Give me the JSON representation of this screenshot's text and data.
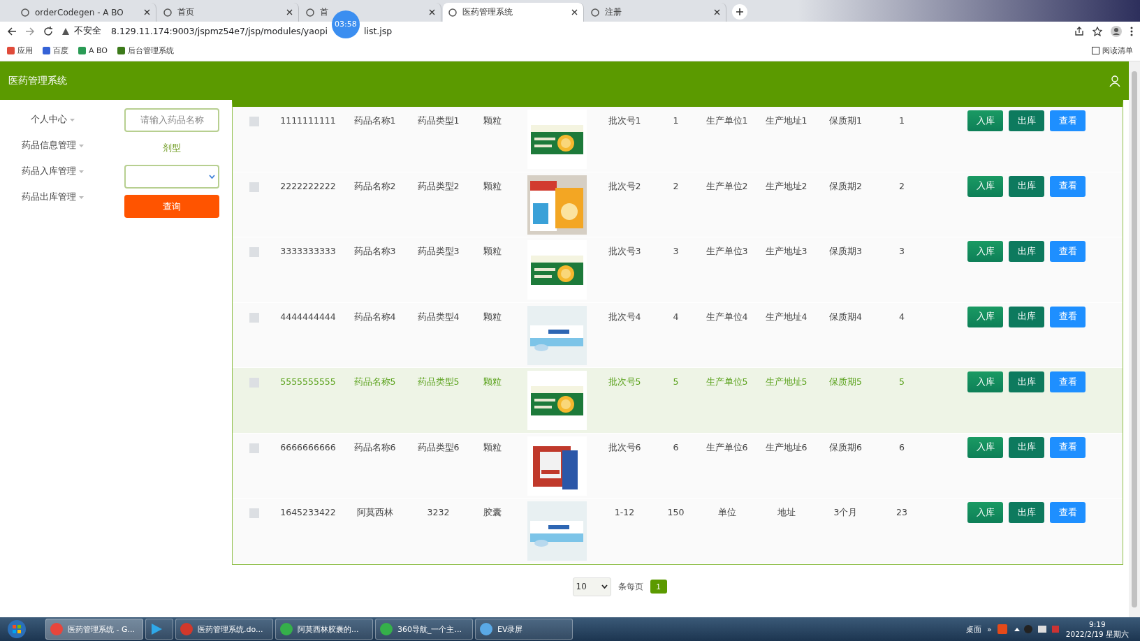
{
  "browser": {
    "tabs": [
      {
        "title": "orderCodegen - A BO",
        "selected": false
      },
      {
        "title": "首页",
        "selected": false
      },
      {
        "title": "首",
        "selected": false
      },
      {
        "title": "医药管理系统",
        "selected": true
      },
      {
        "title": "注册",
        "selected": false
      }
    ],
    "security": "不安全",
    "url_parts": [
      "8.129.11.174:9003/jspmz54e7/jsp/modules/yaopi",
      "list.jsp"
    ],
    "timer": "03:58",
    "bookmarks": [
      "应用",
      "百度",
      "A BO",
      "后台管理系统"
    ],
    "reading_list": "阅读清单"
  },
  "app": {
    "title": "医药管理系统"
  },
  "sidebar": {
    "items": [
      "个人中心",
      "药品信息管理",
      "药品入库管理",
      "药品出库管理"
    ]
  },
  "search": {
    "placeholder": "请输入药品名称",
    "form_label": "剂型",
    "button": "查询"
  },
  "table": {
    "rows": [
      {
        "checked": false,
        "highlighted": false,
        "cells": [
          "1111111111",
          "药品名称1",
          "药品类型1",
          "颗粒"
        ],
        "image": {
          "kind": "picture"
        },
        "cells_after": [
          "批次号1",
          "1",
          "生产单位1",
          "生产地址1",
          "保质期1",
          "1"
        ],
        "actions": [
          {
            "kind": "in",
            "label": "入库"
          },
          {
            "kind": "out",
            "label": "出库"
          },
          {
            "kind": "view",
            "label": "查看"
          }
        ]
      },
      {
        "checked": false,
        "highlighted": false,
        "cells": [
          "2222222222",
          "药品名称2",
          "药品类型2",
          "颗粒"
        ],
        "image": {
          "kind": "picture"
        },
        "cells_after": [
          "批次号2",
          "2",
          "生产单位2",
          "生产地址2",
          "保质期2",
          "2"
        ],
        "actions": [
          {
            "kind": "in",
            "label": "入库"
          },
          {
            "kind": "out",
            "label": "出库"
          },
          {
            "kind": "view",
            "label": "查看"
          }
        ]
      },
      {
        "checked": false,
        "highlighted": false,
        "cells": [
          "3333333333",
          "药品名称3",
          "药品类型3",
          "颗粒"
        ],
        "image": {
          "kind": "picture"
        },
        "cells_after": [
          "批次号3",
          "3",
          "生产单位3",
          "生产地址3",
          "保质期3",
          "3"
        ],
        "actions": [
          {
            "kind": "in",
            "label": "入库"
          },
          {
            "kind": "out",
            "label": "出库"
          },
          {
            "kind": "view",
            "label": "查看"
          }
        ]
      },
      {
        "checked": false,
        "highlighted": false,
        "cells": [
          "4444444444",
          "药品名称4",
          "药品类型4",
          "颗粒"
        ],
        "image": {
          "kind": "picture"
        },
        "cells_after": [
          "批次号4",
          "4",
          "生产单位4",
          "生产地址4",
          "保质期4",
          "4"
        ],
        "actions": [
          {
            "kind": "in",
            "label": "入库"
          },
          {
            "kind": "out",
            "label": "出库"
          },
          {
            "kind": "view",
            "label": "查看"
          }
        ]
      },
      {
        "checked": false,
        "highlighted": true,
        "cells": [
          "5555555555",
          "药品名称5",
          "药品类型5",
          "颗粒"
        ],
        "image": {
          "kind": "picture"
        },
        "cells_after": [
          "批次号5",
          "5",
          "生产单位5",
          "生产地址5",
          "保质期5",
          "5"
        ],
        "actions": [
          {
            "kind": "in",
            "label": "入库"
          },
          {
            "kind": "out",
            "label": "出库"
          },
          {
            "kind": "view",
            "label": "查看"
          }
        ]
      },
      {
        "checked": false,
        "highlighted": false,
        "cells": [
          "6666666666",
          "药品名称6",
          "药品类型6",
          "颗粒"
        ],
        "image": {
          "kind": "picture"
        },
        "cells_after": [
          "批次号6",
          "6",
          "生产单位6",
          "生产地址6",
          "保质期6",
          "6"
        ],
        "actions": [
          {
            "kind": "in",
            "label": "入库"
          },
          {
            "kind": "out",
            "label": "出库"
          },
          {
            "kind": "view",
            "label": "查看"
          }
        ]
      },
      {
        "checked": false,
        "highlighted": false,
        "cells": [
          "1645233422",
          "阿莫西林",
          "3232",
          "胶囊"
        ],
        "image": {
          "kind": "picture"
        },
        "cells_after": [
          "1-12",
          "150",
          "单位",
          "地址",
          "3个月",
          "23"
        ],
        "actions": [
          {
            "kind": "in",
            "label": "入库"
          },
          {
            "kind": "out",
            "label": "出库"
          },
          {
            "kind": "view",
            "label": "查看"
          }
        ]
      }
    ]
  },
  "pagination": {
    "page_size": "10",
    "per_page_label": "条每页",
    "pages": [
      {
        "label": "1",
        "selected": true
      }
    ]
  },
  "taskbar": {
    "items": [
      {
        "label": "医药管理系统 - G...",
        "selected": true,
        "kind": "browser"
      },
      {
        "selected": false,
        "kind": "player"
      },
      {
        "label": "医药管理系统.do...",
        "selected": false,
        "kind": "doc"
      },
      {
        "label": "阿莫西林胶囊的...",
        "selected": false,
        "kind": "nav"
      },
      {
        "label": "360导航_一个主...",
        "selected": false,
        "kind": "nav"
      },
      {
        "label": "EV录屏",
        "selected": false,
        "kind": "rec"
      }
    ],
    "desktop": "桌面",
    "more": "»",
    "time": "9:19",
    "date": "2022/2/19 星期六"
  }
}
